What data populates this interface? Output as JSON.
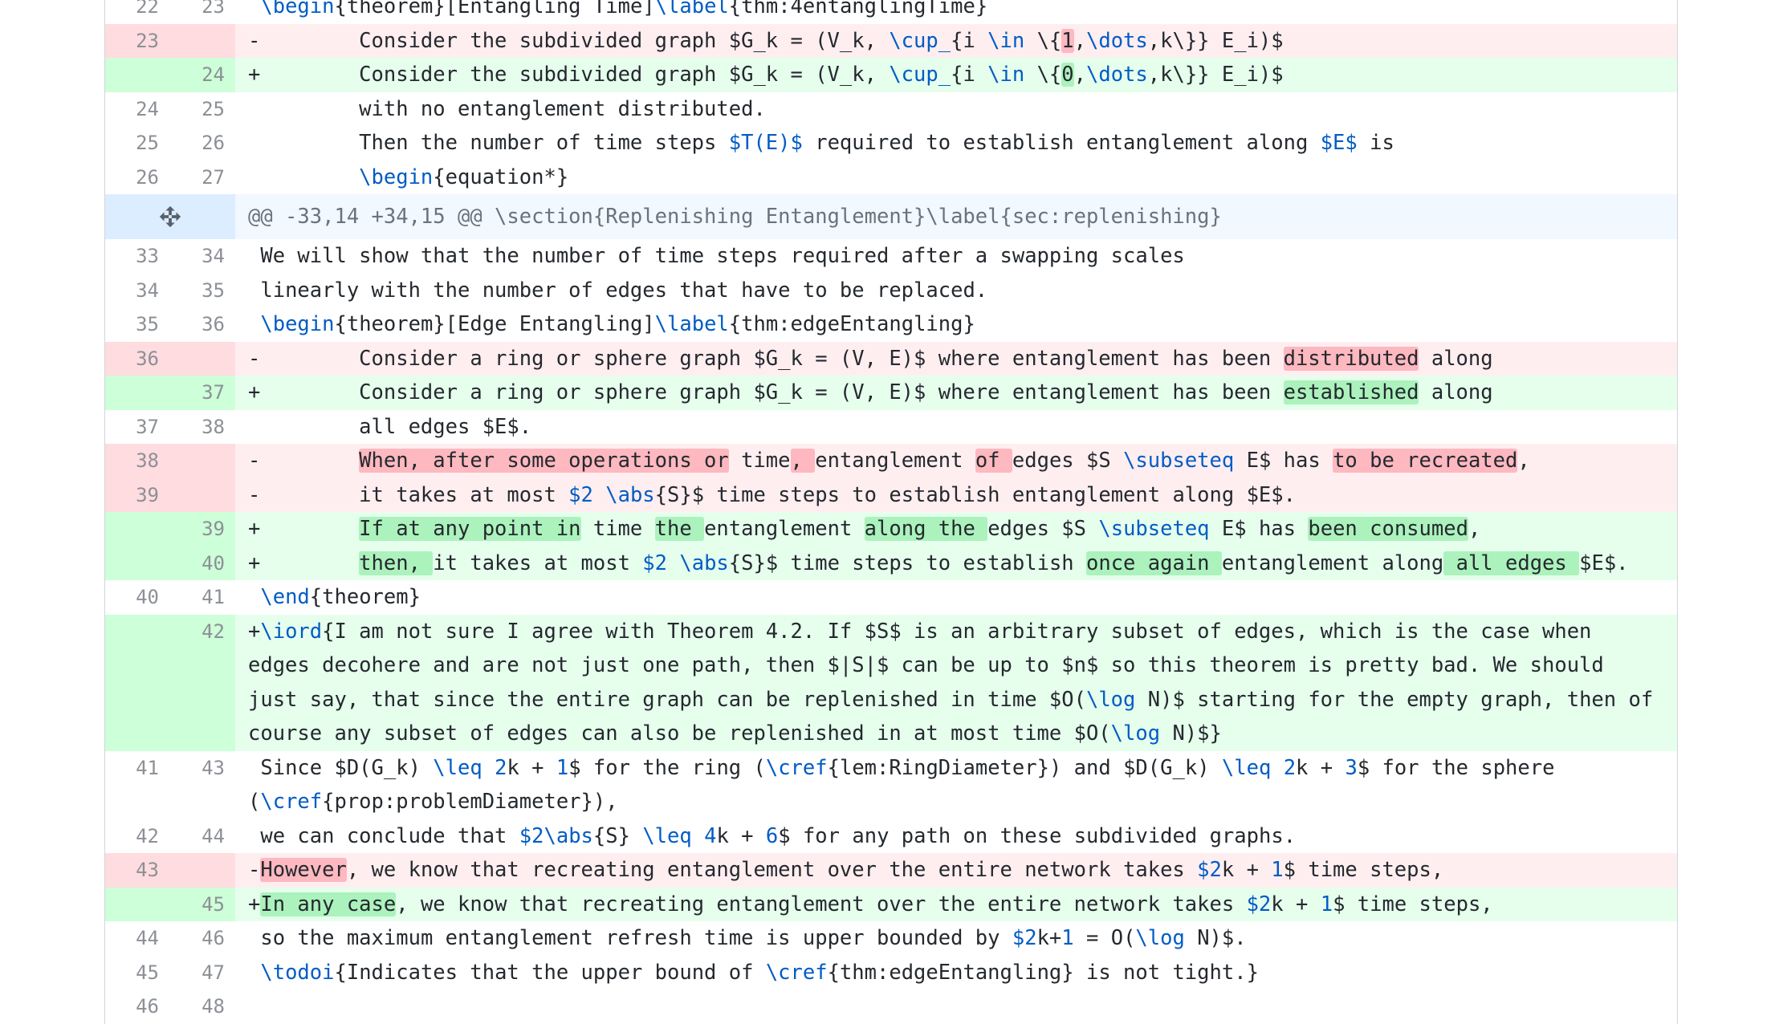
{
  "diff": {
    "rows": [
      {
        "type": "ctx",
        "old": "22",
        "new": "23",
        "segs": [
          {
            "t": " "
          },
          {
            "t": "\\begin",
            "c": "kw"
          },
          {
            "t": "{theorem}[Entangling Time]"
          },
          {
            "t": "\\label",
            "c": "kw"
          },
          {
            "t": "{thm:4entanglingTime}"
          }
        ]
      },
      {
        "type": "del",
        "old": "23",
        "new": "",
        "segs": [
          {
            "t": "-        Consider the subdivided graph $G_k = (V_k, "
          },
          {
            "t": "\\cup_",
            "c": "kw"
          },
          {
            "t": "{i "
          },
          {
            "t": "\\in",
            "c": "kw"
          },
          {
            "t": " \\{"
          },
          {
            "t": "1",
            "h": true
          },
          {
            "t": ","
          },
          {
            "t": "\\dots",
            "c": "kw"
          },
          {
            "t": ",k\\}} E_i)$"
          }
        ]
      },
      {
        "type": "add",
        "old": "",
        "new": "24",
        "segs": [
          {
            "t": "+        Consider the subdivided graph $G_k = (V_k, "
          },
          {
            "t": "\\cup_",
            "c": "kw"
          },
          {
            "t": "{i "
          },
          {
            "t": "\\in",
            "c": "kw"
          },
          {
            "t": " \\{"
          },
          {
            "t": "0",
            "h": true
          },
          {
            "t": ","
          },
          {
            "t": "\\dots",
            "c": "kw"
          },
          {
            "t": ",k\\}} E_i)$"
          }
        ]
      },
      {
        "type": "ctx",
        "old": "24",
        "new": "25",
        "segs": [
          {
            "t": "         with no entanglement distributed."
          }
        ]
      },
      {
        "type": "ctx",
        "old": "25",
        "new": "26",
        "segs": [
          {
            "t": "         Then the number of time steps "
          },
          {
            "t": "$T(E)$",
            "c": "kw"
          },
          {
            "t": " required to establish entanglement along "
          },
          {
            "t": "$E$",
            "c": "kw"
          },
          {
            "t": " is"
          }
        ]
      },
      {
        "type": "ctx",
        "old": "26",
        "new": "27",
        "segs": [
          {
            "t": "         "
          },
          {
            "t": "\\begin",
            "c": "kw"
          },
          {
            "t": "{equation*}"
          }
        ]
      },
      {
        "type": "hunk",
        "text": "@@ -33,14 +34,15 @@ \\section{Replenishing Entanglement}\\label{sec:replenishing}"
      },
      {
        "type": "ctx",
        "old": "33",
        "new": "34",
        "segs": [
          {
            "t": " We will show that the number of time steps required after a swapping scales"
          }
        ]
      },
      {
        "type": "ctx",
        "old": "34",
        "new": "35",
        "segs": [
          {
            "t": " linearly with the number of edges that have to be replaced."
          }
        ]
      },
      {
        "type": "ctx",
        "old": "35",
        "new": "36",
        "segs": [
          {
            "t": " "
          },
          {
            "t": "\\begin",
            "c": "kw"
          },
          {
            "t": "{theorem}[Edge Entangling]"
          },
          {
            "t": "\\label",
            "c": "kw"
          },
          {
            "t": "{thm:edgeEntangling}"
          }
        ]
      },
      {
        "type": "del",
        "old": "36",
        "new": "",
        "segs": [
          {
            "t": "-        Consider a ring or sphere graph $G_k = (V, E)$ where entanglement has been "
          },
          {
            "t": "distributed",
            "h": true
          },
          {
            "t": " along"
          }
        ]
      },
      {
        "type": "add",
        "old": "",
        "new": "37",
        "segs": [
          {
            "t": "+        Consider a ring or sphere graph $G_k = (V, E)$ where entanglement has been "
          },
          {
            "t": "established",
            "h": true
          },
          {
            "t": " along"
          }
        ]
      },
      {
        "type": "ctx",
        "old": "37",
        "new": "38",
        "segs": [
          {
            "t": "         all edges $E$."
          }
        ]
      },
      {
        "type": "del",
        "old": "38",
        "new": "",
        "segs": [
          {
            "t": "-        "
          },
          {
            "t": "When, after some operations or",
            "h": true
          },
          {
            "t": " time"
          },
          {
            "t": ", ",
            "h": true
          },
          {
            "t": "entanglement "
          },
          {
            "t": "of ",
            "h": true
          },
          {
            "t": "edges $S "
          },
          {
            "t": "\\subseteq",
            "c": "kw"
          },
          {
            "t": " E$ has "
          },
          {
            "t": "to be recreated",
            "h": true
          },
          {
            "t": ","
          }
        ]
      },
      {
        "type": "del",
        "old": "39",
        "new": "",
        "segs": [
          {
            "t": "-        it takes at most "
          },
          {
            "t": "$2 ",
            "c": "kw"
          },
          {
            "t": "\\abs",
            "c": "kw"
          },
          {
            "t": "{S}$ time steps to establish entanglement along $E$."
          }
        ]
      },
      {
        "type": "add",
        "old": "",
        "new": "39",
        "segs": [
          {
            "t": "+        "
          },
          {
            "t": "If at any point in",
            "h": true
          },
          {
            "t": " time "
          },
          {
            "t": "the ",
            "h": true
          },
          {
            "t": "entanglement "
          },
          {
            "t": "along the ",
            "h": true
          },
          {
            "t": "edges $S "
          },
          {
            "t": "\\subseteq",
            "c": "kw"
          },
          {
            "t": " E$ has "
          },
          {
            "t": "been consumed",
            "h": true
          },
          {
            "t": ","
          }
        ]
      },
      {
        "type": "add",
        "old": "",
        "new": "40",
        "segs": [
          {
            "t": "+        "
          },
          {
            "t": "then, ",
            "h": true
          },
          {
            "t": "it takes at most "
          },
          {
            "t": "$2 ",
            "c": "kw"
          },
          {
            "t": "\\abs",
            "c": "kw"
          },
          {
            "t": "{S}$ time steps to establish "
          },
          {
            "t": "once again ",
            "h": true
          },
          {
            "t": "entanglement along"
          },
          {
            "t": " all edges ",
            "h": true
          },
          {
            "t": "$E$."
          }
        ]
      },
      {
        "type": "ctx",
        "old": "40",
        "new": "41",
        "segs": [
          {
            "t": " "
          },
          {
            "t": "\\end",
            "c": "kw"
          },
          {
            "t": "{theorem}"
          }
        ]
      },
      {
        "type": "add",
        "old": "",
        "new": "42",
        "segs": [
          {
            "t": "+"
          },
          {
            "t": "\\iord",
            "c": "kw"
          },
          {
            "t": "{I am not sure I agree with Theorem 4.2. If $S$ is an arbitrary subset of edges, which is the case when edges decohere and are not just one path, then $|S|$ can be up to $n$ so this theorem is pretty bad. We should just say, that since the entire graph can be replenished in time $O("
          },
          {
            "t": "\\log",
            "c": "kw"
          },
          {
            "t": " N)$ starting for the empty graph, then of course any subset of edges can also be replenished in at most time $O("
          },
          {
            "t": "\\log",
            "c": "kw"
          },
          {
            "t": " N)$}"
          }
        ]
      },
      {
        "type": "ctx",
        "old": "41",
        "new": "43",
        "segs": [
          {
            "t": " Since $D(G_k) "
          },
          {
            "t": "\\leq",
            "c": "kw"
          },
          {
            "t": " "
          },
          {
            "t": "2",
            "c": "kw"
          },
          {
            "t": "k + "
          },
          {
            "t": "1",
            "c": "kw"
          },
          {
            "t": "$ for the ring ("
          },
          {
            "t": "\\cref",
            "c": "kw"
          },
          {
            "t": "{lem:RingDiameter}) and $D(G_k) "
          },
          {
            "t": "\\leq",
            "c": "kw"
          },
          {
            "t": " "
          },
          {
            "t": "2",
            "c": "kw"
          },
          {
            "t": "k + "
          },
          {
            "t": "3",
            "c": "kw"
          },
          {
            "t": "$ for the sphere ("
          },
          {
            "t": "\\cref",
            "c": "kw"
          },
          {
            "t": "{prop:problemDiameter}),"
          }
        ]
      },
      {
        "type": "ctx",
        "old": "42",
        "new": "44",
        "segs": [
          {
            "t": " we can conclude that "
          },
          {
            "t": "$2",
            "c": "kw"
          },
          {
            "t": "\\abs",
            "c": "kw"
          },
          {
            "t": "{S} "
          },
          {
            "t": "\\leq",
            "c": "kw"
          },
          {
            "t": " "
          },
          {
            "t": "4",
            "c": "kw"
          },
          {
            "t": "k + "
          },
          {
            "t": "6",
            "c": "kw"
          },
          {
            "t": "$ for any path on these subdivided graphs."
          }
        ]
      },
      {
        "type": "del",
        "old": "43",
        "new": "",
        "segs": [
          {
            "t": "-"
          },
          {
            "t": "However",
            "h": true
          },
          {
            "t": ", we know that recreating entanglement over the entire network takes "
          },
          {
            "t": "$2",
            "c": "kw"
          },
          {
            "t": "k + "
          },
          {
            "t": "1",
            "c": "kw"
          },
          {
            "t": "$ time steps,"
          }
        ]
      },
      {
        "type": "add",
        "old": "",
        "new": "45",
        "segs": [
          {
            "t": "+"
          },
          {
            "t": "In any case",
            "h": true
          },
          {
            "t": ", we know that recreating entanglement over the entire network takes "
          },
          {
            "t": "$2",
            "c": "kw"
          },
          {
            "t": "k + "
          },
          {
            "t": "1",
            "c": "kw"
          },
          {
            "t": "$ time steps,"
          }
        ]
      },
      {
        "type": "ctx",
        "old": "44",
        "new": "46",
        "segs": [
          {
            "t": " so the maximum entanglement refresh time is upper bounded by "
          },
          {
            "t": "$2",
            "c": "kw"
          },
          {
            "t": "k+"
          },
          {
            "t": "1",
            "c": "kw"
          },
          {
            "t": " = O("
          },
          {
            "t": "\\log",
            "c": "kw"
          },
          {
            "t": " N)$."
          }
        ]
      },
      {
        "type": "ctx",
        "old": "45",
        "new": "47",
        "segs": [
          {
            "t": " "
          },
          {
            "t": "\\todoi",
            "c": "kw"
          },
          {
            "t": "{Indicates that the upper bound of "
          },
          {
            "t": "\\cref",
            "c": "kw"
          },
          {
            "t": "{thm:edgeEntangling} is not tight.}"
          }
        ]
      },
      {
        "type": "ctx",
        "old": "46",
        "new": "48",
        "segs": [
          {
            "t": ""
          }
        ]
      }
    ]
  }
}
